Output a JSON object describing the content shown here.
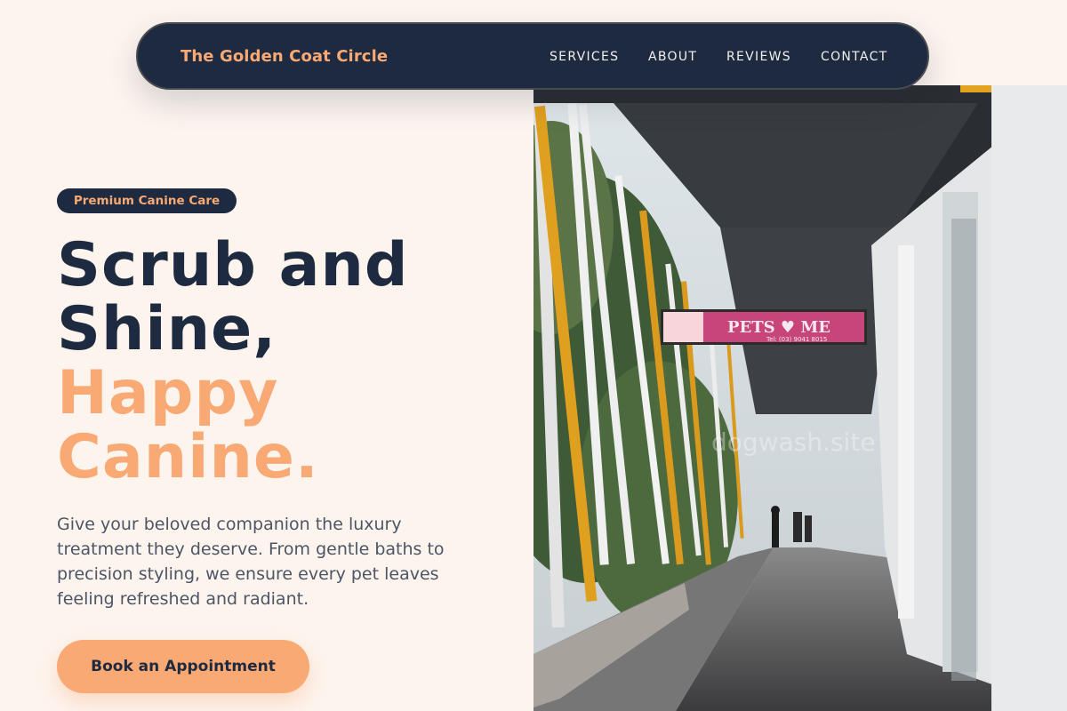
{
  "nav": {
    "brand": "The Golden Coat Circle",
    "links": [
      "SERVICES",
      "ABOUT",
      "REVIEWS",
      "CONTACT"
    ]
  },
  "hero": {
    "badge": "Premium Canine Care",
    "headline": {
      "line1": "Scrub and",
      "line2": "Shine,",
      "accent1": "Happy",
      "accent2": "Canine."
    },
    "description": "Give your beloved companion the luxury treatment they deserve. From gentle baths to precision styling, we ensure every pet leaves feeling refreshed and radiant.",
    "cta_label": "Book an Appointment",
    "photo": {
      "sign_text": "PETS ♥ ME",
      "sign_phone": "Tel: (03) 9041 8015",
      "watermark": "dogwash.site"
    }
  },
  "colors": {
    "background": "#fdf4ee",
    "navy": "#1e2a40",
    "accent": "#f9a973",
    "body_text": "#4c5566"
  }
}
